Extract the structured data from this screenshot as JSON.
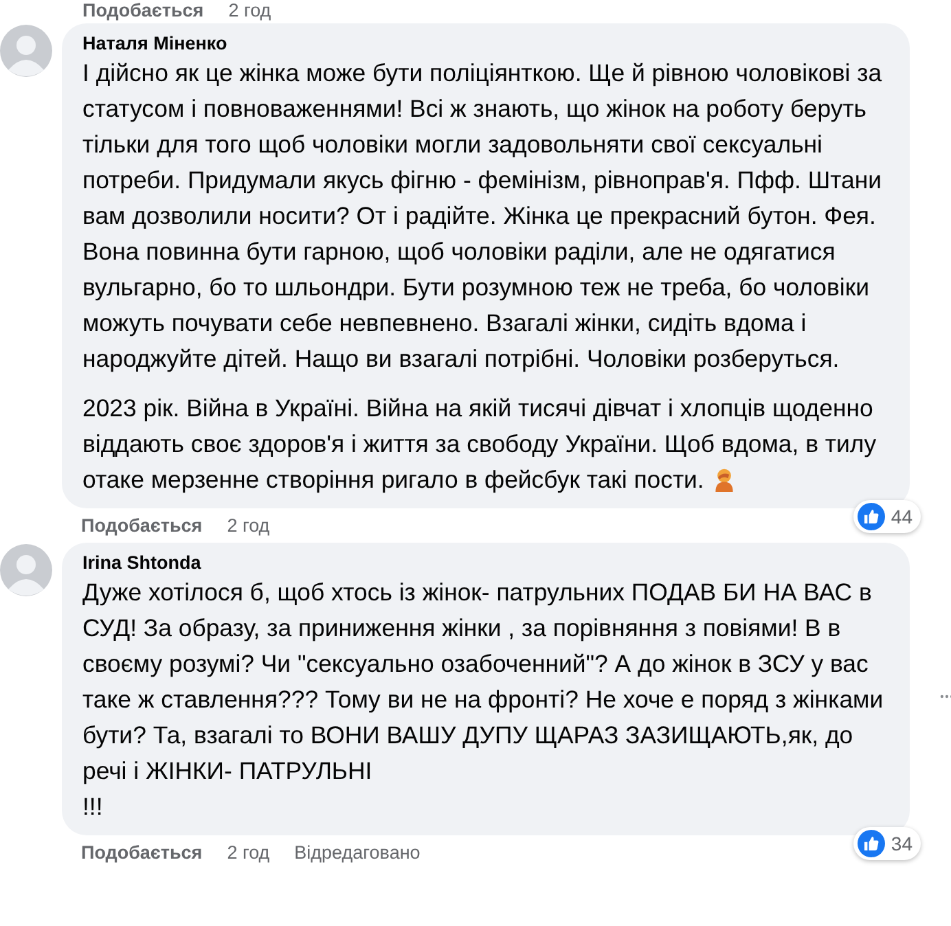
{
  "top_actions": {
    "like": "Подобається",
    "time": "2 год"
  },
  "comments": [
    {
      "author": "Наталя Міненко",
      "paragraphs": [
        {
          "text": "І дійсно як це жінка може бути поліціянткою. Ще й рівною чоловікові за статусом і повноваженнями! Всі ж знають, що жінок на роботу беруть тільки для того щоб чоловіки могли задовольняти свої сексуальні потреби. Придумали якусь фігню - фемінізм, рівноправ'я. Пфф. Штани вам дозволили носити? От і радійте. Жінка це прекрасний бутон. Фея. Вона повинна бути гарною, щоб чоловіки раділи, але не одягатися вульгарно, бо то шльондри. Бути розумною теж не треба, бо чоловіки можуть почувати себе невпевнено. Взагалі жінки, сидіть вдома і народжуйте дітей. Нащо ви взагалі потрібні. Чоловіки розберуться.",
          "emoji": false
        },
        {
          "text": "2023 рік. Війна в Україні. Війна на якій тисячі дівчат і хлопців щоденно віддають своє здоров'я і життя за свободу України. Щоб вдома, в тилу отаке мерзенне створіння ригало в фейсбук такі пости.",
          "emoji": true
        }
      ],
      "reactions": "44",
      "like": "Подобається",
      "time": "2 год",
      "more_menu": false
    },
    {
      "author": "Irina Shtonda",
      "paragraphs": [
        {
          "text": "Дуже хотілося б, щоб хтось із жінок- патрульних ПОДАВ БИ НА ВАС в СУД! За образу, за приниження жінки , за порівняння з повіями! В в своєму розумі? Чи \"сексуально озабоченний\"? А до жінок в ЗСУ у вас таке ж ставлення??? Тому ви не на фронті? Не хоче е поряд з жінками бути? Та, взагалі то ВОНИ ВАШУ ДУПУ ЩАРАЗ ЗАЗИЩАЮТЬ,як, до речі і ЖІНКИ- ПАТРУЛЬНІ\n!!!",
          "emoji": false
        }
      ],
      "reactions": "34",
      "like": "Подобається",
      "time": "2 год",
      "edited": "Відредаговано",
      "more_menu": true
    }
  ]
}
